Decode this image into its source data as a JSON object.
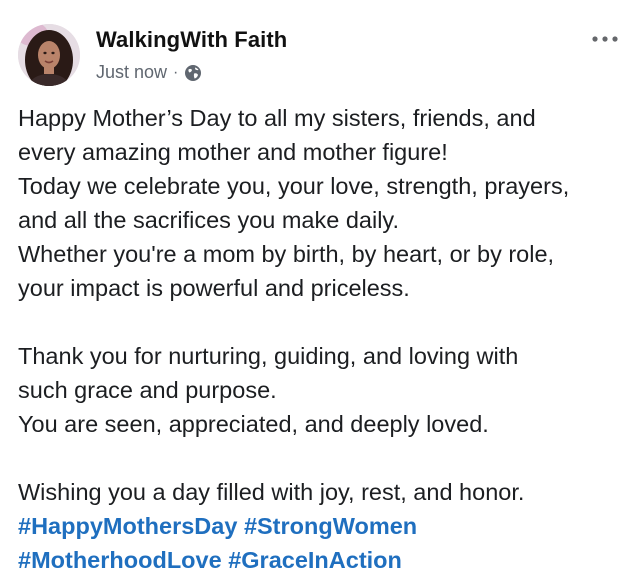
{
  "post": {
    "author": "WalkingWith Faith",
    "timestamp": "Just now",
    "separator": "·",
    "privacy_icon": "globe-icon",
    "more_icon": "more-horizontal-icon",
    "lines": [
      "Happy Mother’s Day to all my sisters, friends, and",
      "every amazing mother and mother figure!",
      "Today we celebrate you, your love, strength, prayers,",
      "and all the sacrifices you make daily.",
      "Whether you're a mom by birth, by heart, or by role,",
      "your impact is powerful and priceless.",
      "",
      "Thank you for nurturing, guiding, and loving with",
      "such grace and purpose.",
      "You are seen, appreciated, and deeply loved.",
      "",
      "Wishing you a day filled with joy, rest, and honor."
    ],
    "hashtags": [
      "#HappyMothersDay",
      "#StrongWomen",
      "#MotherhoodLove",
      "#GraceInAction"
    ]
  },
  "colors": {
    "hashtag": "#1f6fbf",
    "meta_text": "#606770",
    "body_text": "#1c1e21"
  }
}
